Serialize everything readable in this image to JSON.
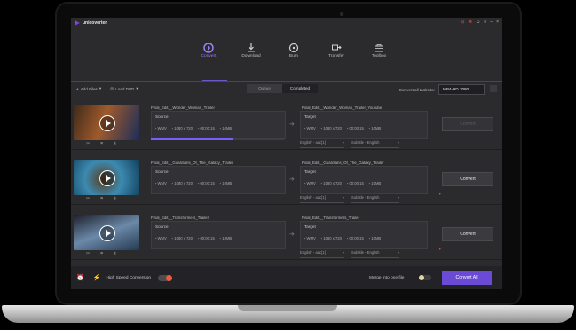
{
  "app": {
    "name": "unicoverter",
    "window_icons": [
      "cart-icon",
      "gift-icon",
      "user-icon",
      "menu-icon",
      "minimize-icon",
      "close-icon"
    ]
  },
  "nav": [
    {
      "label": "Convert",
      "icon": "convert-icon",
      "active": true
    },
    {
      "label": "Download",
      "icon": "download-icon",
      "active": false
    },
    {
      "label": "Burn",
      "icon": "burn-icon",
      "active": false
    },
    {
      "label": "Transfer",
      "icon": "transfer-icon",
      "active": false
    },
    {
      "label": "Toolbox",
      "icon": "toolbox-icon",
      "active": false
    }
  ],
  "toolbar": {
    "add_files": "Add Files",
    "load_dvd": "Load DVD",
    "tab_queue": "Queue",
    "tab_completed": "Completed",
    "convert_all_to_label": "Convert all tasks to:",
    "format_value": "MP4-HD 1080"
  },
  "rows": [
    {
      "title": "Final_Edit__Wonder_Woman_Trailer",
      "target_title": "Final_Edit__Wonder_Woman_Trailer_Youtube",
      "source_label": "Source",
      "target_label": "Target",
      "src_meta": {
        "format": "WMV",
        "resolution": "1080 x 720",
        "duration": "00:00:15",
        "size": "10MB"
      },
      "tgt_meta": {
        "format": "WMV",
        "resolution": "1080 x 720",
        "duration": "00:00:15",
        "size": "10MB"
      },
      "audio": "English - aac[1]",
      "subtitle": "Subtitle - English",
      "button": "Convert",
      "progress": 0.62,
      "thumb_colors": [
        "#3f2a1a",
        "#a05a2c",
        "#1b2d5a"
      ]
    },
    {
      "title": "Final_Edit__Guardians_Of_The_Galaxy_Trailer",
      "target_title": "Final_Edit__Guardians_Of_The_Galaxy_Trailer",
      "source_label": "Source",
      "target_label": "Target",
      "src_meta": {
        "format": "WMV",
        "resolution": "1080 x 720",
        "duration": "00:00:15",
        "size": "10MB"
      },
      "tgt_meta": {
        "format": "WMV",
        "resolution": "1080 x 720",
        "duration": "00:00:15",
        "size": "10MB"
      },
      "audio": "English - aac[1]",
      "subtitle": "Subtitle - English",
      "button": "Convert",
      "thumb_colors": [
        "#123f5c",
        "#3c8ab0",
        "#5a3b1e"
      ]
    },
    {
      "title": "Final_Edit__Transformers_Trailer",
      "target_title": "Final_Edit__Transformers_Trailer",
      "source_label": "Source",
      "target_label": "Target",
      "src_meta": {
        "format": "WMV",
        "resolution": "1080 x 720",
        "duration": "00:00:15",
        "size": "10MB"
      },
      "tgt_meta": {
        "format": "WMV",
        "resolution": "1080 x 720",
        "duration": "00:00:15",
        "size": "10MB"
      },
      "audio": "English - aac[1]",
      "subtitle": "Subtitle - English",
      "button": "Convert",
      "thumb_colors": [
        "#243a52",
        "#6b89a8",
        "#1d1f2b"
      ]
    }
  ],
  "bottom": {
    "high_speed": "High Speed Conversion",
    "merge": "Merge into one file",
    "convert_all": "Convert All"
  },
  "colors": {
    "accent": "#6b4bd6",
    "bolt": "#e25b4e",
    "background": "#2b2a2d"
  }
}
